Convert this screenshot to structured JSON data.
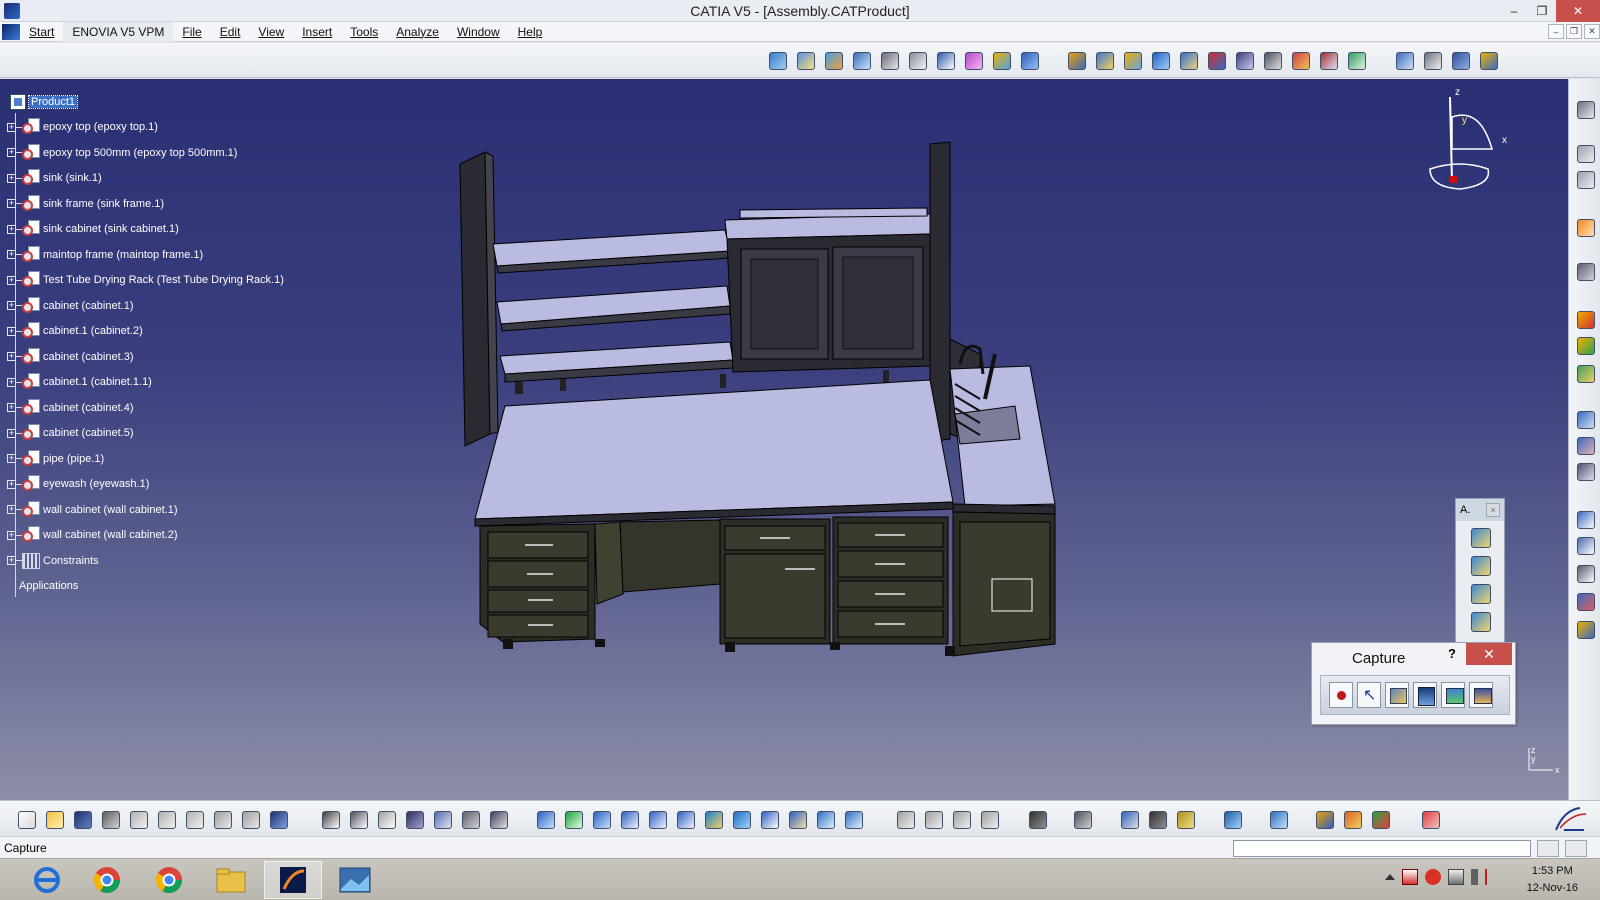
{
  "window": {
    "title": "CATIA V5 - [Assembly.CATProduct]",
    "minimize": "–",
    "restore": "❐",
    "close": "✕"
  },
  "menu": {
    "items": [
      "Start",
      "ENOVIA V5 VPM",
      "File",
      "Edit",
      "View",
      "Insert",
      "Tools",
      "Analyze",
      "Window",
      "Help"
    ],
    "doc_controls": [
      "–",
      "❐",
      "✕"
    ]
  },
  "tree": {
    "root": "Product1",
    "items": [
      "epoxy top (epoxy top.1)",
      "epoxy top 500mm (epoxy top 500mm.1)",
      "sink (sink.1)",
      "sink frame (sink frame.1)",
      "sink cabinet (sink cabinet.1)",
      "maintop frame (maintop frame.1)",
      "Test Tube Drying Rack (Test Tube Drying Rack.1)",
      "cabinet (cabinet.1)",
      "cabinet.1 (cabinet.2)",
      "cabinet (cabinet.3)",
      "cabinet.1 (cabinet.1.1)",
      "cabinet (cabinet.4)",
      "cabinet (cabinet.5)",
      "pipe (pipe.1)",
      "eyewash (eyewash.1)",
      "wall cabinet (wall cabinet.1)",
      "wall cabinet (wall cabinet.2)"
    ],
    "constraints": "Constraints",
    "applications": "Applications"
  },
  "compass": {
    "z": "z",
    "y": "y",
    "x": "x"
  },
  "float_toolbar": {
    "title": "A.",
    "close": "×"
  },
  "capture": {
    "title": "Capture",
    "help": "?",
    "close": "✕"
  },
  "mini_axis": {
    "z": "z",
    "y": "y",
    "x": "x"
  },
  "status": {
    "text": "Capture"
  },
  "taskbar": {
    "time": "1:53 PM",
    "date": "12-Nov-16"
  },
  "colors": {
    "viewport_top": "#2a2f74",
    "viewport_bottom": "#8d8fa8",
    "selection": "#3a6fc8",
    "close_red": "#c7504b"
  }
}
